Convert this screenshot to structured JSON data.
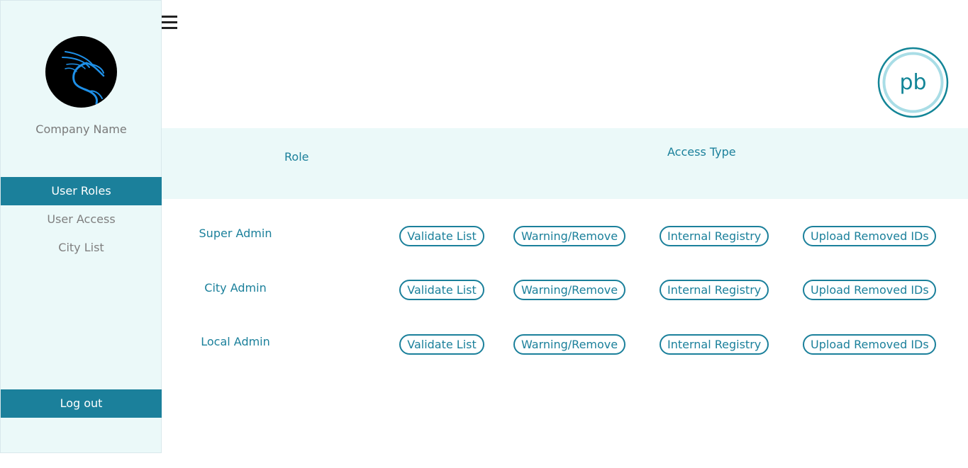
{
  "sidebar": {
    "avatar_icon": "kali-dragon-logo",
    "company_name": "Company Name",
    "items": [
      {
        "label": "User Roles",
        "active": true
      },
      {
        "label": "User Access",
        "active": false
      },
      {
        "label": "City List",
        "active": false
      }
    ],
    "logout_label": "Log out"
  },
  "header": {
    "menu_icon": "hamburger-menu-icon",
    "brand_logo_text": "pb"
  },
  "table": {
    "columns": {
      "role": "Role",
      "access_type": "Access Type"
    },
    "rows": [
      {
        "role": "Super Admin",
        "access": [
          "Validate List",
          "Warning/Remove",
          "Internal Registry",
          "Upload Removed IDs"
        ]
      },
      {
        "role": "City Admin",
        "access": [
          "Validate List",
          "Warning/Remove",
          "Internal Registry",
          "Upload Removed IDs"
        ]
      },
      {
        "role": "Local Admin",
        "access": [
          "Validate List",
          "Warning/Remove",
          "Internal Registry",
          "Upload Removed IDs"
        ]
      }
    ]
  },
  "colors": {
    "accent": "#1b809b",
    "sidebar_bg": "#ebf9f9",
    "muted_text": "#7f7f7f"
  }
}
